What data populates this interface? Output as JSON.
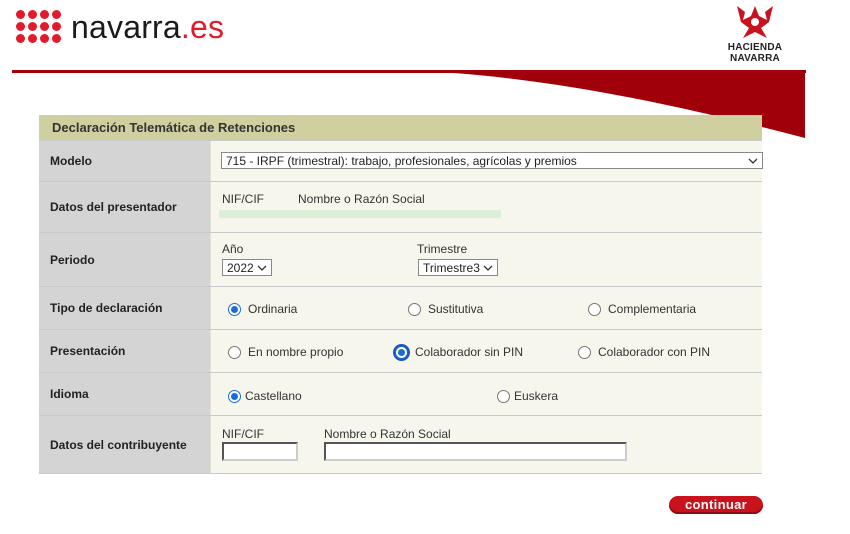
{
  "header": {
    "logo": {
      "name": "navarra",
      "tld": ".es"
    },
    "hacienda": {
      "line1": "HACIENDA",
      "line2": "NAVARRA"
    }
  },
  "form": {
    "title": "Declaración Telemática de Retenciones",
    "modelo": {
      "label": "Modelo",
      "selected": "715 - IRPF (trimestral): trabajo, profesionales, agrícolas y premios"
    },
    "presentador": {
      "label": "Datos del presentador",
      "nif_label": "NIF/CIF",
      "nombre_label": "Nombre o Razón Social"
    },
    "periodo": {
      "label": "Periodo",
      "anio_label": "Año",
      "anio_value": "2022",
      "trimestre_label": "Trimestre",
      "trimestre_value": "Trimestre3"
    },
    "tipo": {
      "label": "Tipo de declaración",
      "options": [
        "Ordinaria",
        "Sustitutiva",
        "Complementaria"
      ],
      "selected": "Ordinaria"
    },
    "presentacion": {
      "label": "Presentación",
      "options": [
        "En nombre propio",
        "Colaborador sin PIN",
        "Colaborador con PIN"
      ],
      "selected": "Colaborador sin PIN"
    },
    "idioma": {
      "label": "Idioma",
      "options": [
        "Castellano",
        "Euskera"
      ],
      "selected": "Castellano"
    },
    "contribuyente": {
      "label": "Datos del contribuyente",
      "nif_label": "NIF/CIF",
      "nombre_label": "Nombre o Razón Social",
      "nif_value": "",
      "nombre_value": ""
    }
  },
  "actions": {
    "continuar": "continuar"
  },
  "colors": {
    "brand_red": "#e21b2c",
    "banner_red": "#a0000a",
    "title_bar": "#cfcf9f",
    "button_red": "#c8121d"
  }
}
